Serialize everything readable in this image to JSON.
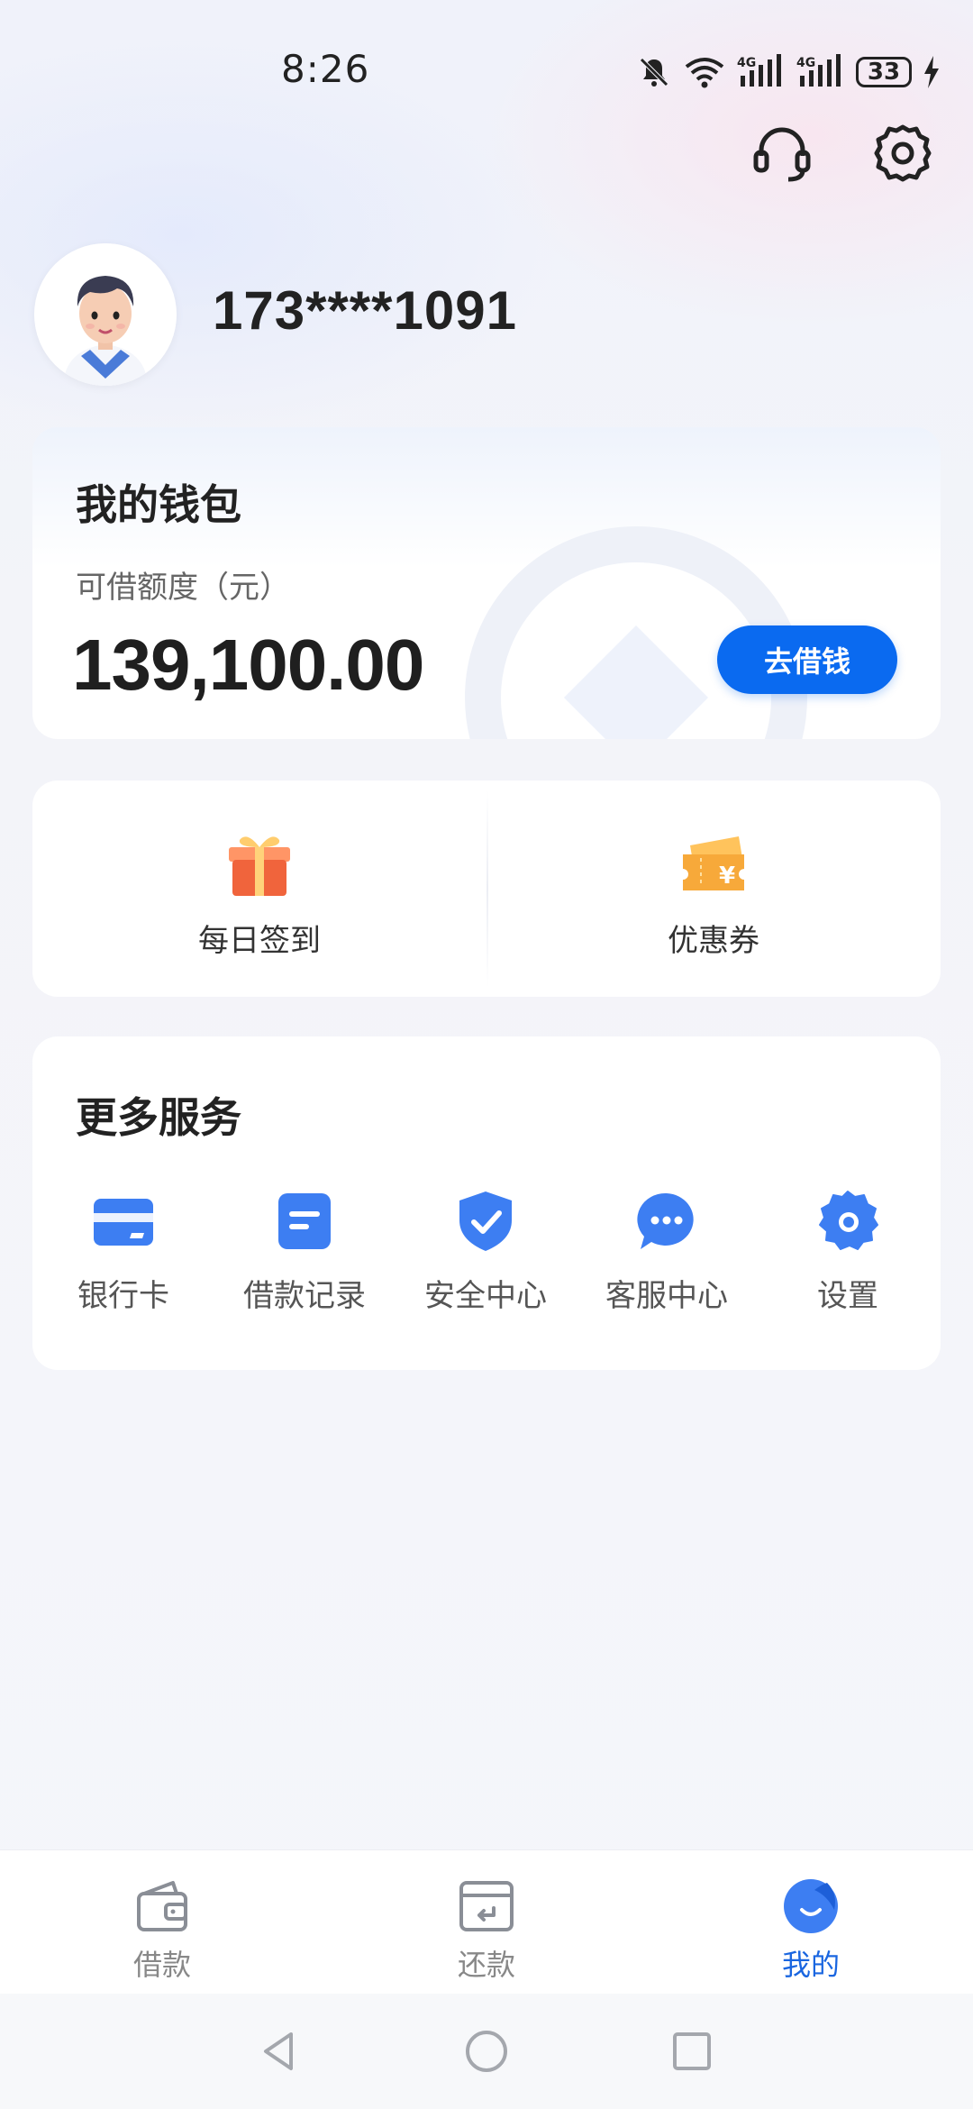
{
  "status": {
    "time": "8:26",
    "battery": "33",
    "signal1": "4G",
    "signal2": "4G"
  },
  "profile": {
    "phone": "173****1091"
  },
  "wallet": {
    "title": "我的钱包",
    "credit_label": "可借额度（元）",
    "credit_amount": "139,100.00",
    "borrow_button": "去借钱"
  },
  "quick": [
    {
      "label": "每日签到",
      "icon": "gift-icon"
    },
    {
      "label": "优惠券",
      "icon": "coupon-icon"
    }
  ],
  "services": {
    "title": "更多服务",
    "items": [
      {
        "label": "银行卡",
        "icon": "bank-card-icon"
      },
      {
        "label": "借款记录",
        "icon": "loan-record-icon"
      },
      {
        "label": "安全中心",
        "icon": "security-shield-icon"
      },
      {
        "label": "客服中心",
        "icon": "customer-service-chat-icon"
      },
      {
        "label": "设置",
        "icon": "settings-gear-icon"
      }
    ]
  },
  "tabs": [
    {
      "label": "借款",
      "icon": "wallet-icon",
      "active": false
    },
    {
      "label": "还款",
      "icon": "repay-icon",
      "active": false
    },
    {
      "label": "我的",
      "icon": "profile-smile-icon",
      "active": true
    }
  ],
  "colors": {
    "accent": "#0a6af0",
    "tab_active": "#1a66e0",
    "service_icon": "#3d7ef2"
  }
}
